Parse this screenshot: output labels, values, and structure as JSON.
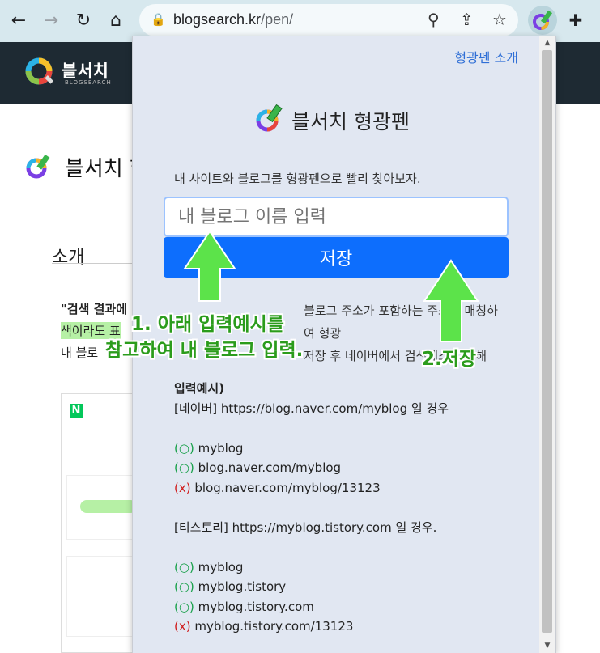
{
  "browser": {
    "url_host": "blogsearch.kr",
    "url_path": "/pen/",
    "icons": [
      "back-icon",
      "forward-icon",
      "reload-icon",
      "home-icon",
      "lock-icon",
      "zoom-icon",
      "share-icon",
      "star-icon",
      "extension-pen-icon",
      "puzzle-icon"
    ]
  },
  "site": {
    "logo_text": "블서치",
    "logo_sub": "BLOGSEARCH",
    "page_title": "블서치 형",
    "section": "소개",
    "para_lines": [
      "\"검색 결과에",
      "색이라도 표",
      "내 블로"
    ]
  },
  "popup": {
    "intro_link": "형광펜 소개",
    "title": "블서치 형광펜",
    "subtitle": "내 사이트와 블로그를 형광펜으로 빨리 찾아보자.",
    "input_placeholder": "내 블로그 이름 입력",
    "save_label": "저장",
    "desc_line1": "블로그 주소가 포함하는 주소만 매칭하여 형광",
    "desc_line2": "저장 후 네이버에서 검색테스트를 해",
    "examples_head": "입력예시)",
    "naver_line": "[네이버] https://blog.naver.com/myblog 일 경우",
    "naver_ok1": "myblog",
    "naver_ok2": "blog.naver.com/myblog",
    "naver_no": "blog.naver.com/myblog/13123",
    "tistory_line": "[티스토리] https://myblog.tistory.com 일 경우.",
    "tistory_ok1": "myblog",
    "tistory_ok2": "myblog.tistory",
    "tistory_ok3": "myblog.tistory.com",
    "tistory_no": "myblog.tistory.com/13123",
    "ok_mark": "(○)",
    "no_mark": "(x)"
  },
  "annotations": {
    "step1_line1": "1. 아래 입력예시를",
    "step1_line2": "참고하여 내 블로그 입력.",
    "step2": "2.저장"
  },
  "colors": {
    "annotation_green": "#2b9c1c",
    "button_blue": "#0d6efd",
    "popup_bg": "#e1e7f2",
    "header_dark": "#1e2a33"
  }
}
